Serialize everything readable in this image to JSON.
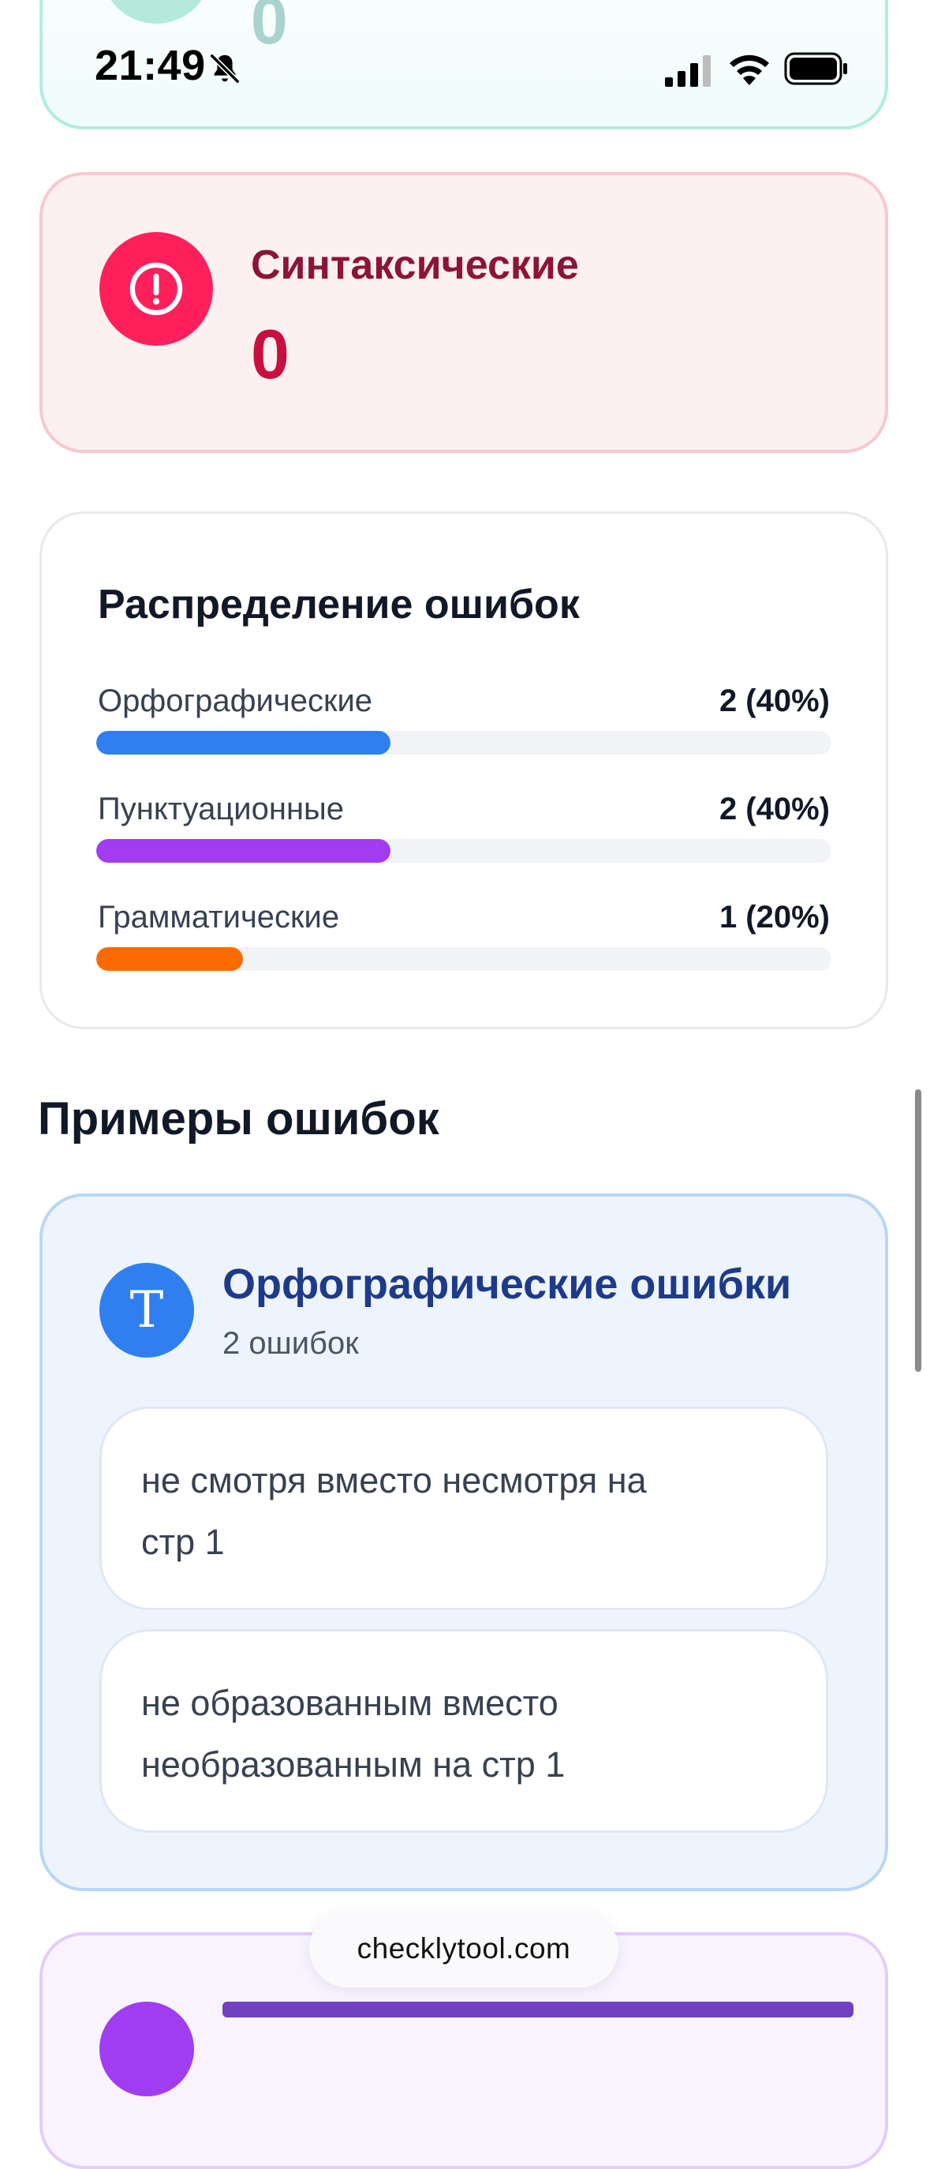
{
  "status_bar": {
    "time": "21:49"
  },
  "top_card": {
    "value": "0"
  },
  "syntax_card": {
    "title": "Синтаксические",
    "value": "0"
  },
  "distribution": {
    "title": "Распределение ошибок",
    "rows": [
      {
        "label": "Орфографические",
        "count": "2 (40%)",
        "fraction": 0.4,
        "color": "#2f7ff0"
      },
      {
        "label": "Пунктуационные",
        "count": "2 (40%)",
        "fraction": 0.4,
        "color": "#a33cf0"
      },
      {
        "label": "Грамматические",
        "count": "1 (20%)",
        "fraction": 0.2,
        "color": "#ff6a00"
      }
    ]
  },
  "examples": {
    "title": "Примеры ошибок",
    "spelling": {
      "icon_letter": "T",
      "title": "Орфографические ошибки",
      "subtitle": "2 ошибок",
      "items": [
        {
          "line1": "не смотря вместо несмотря на",
          "line2": "стр 1"
        },
        {
          "line1": "не образованным вместо",
          "line2": "необразованным на стр 1"
        }
      ]
    }
  },
  "browser": {
    "url": "checklytool.com"
  }
}
